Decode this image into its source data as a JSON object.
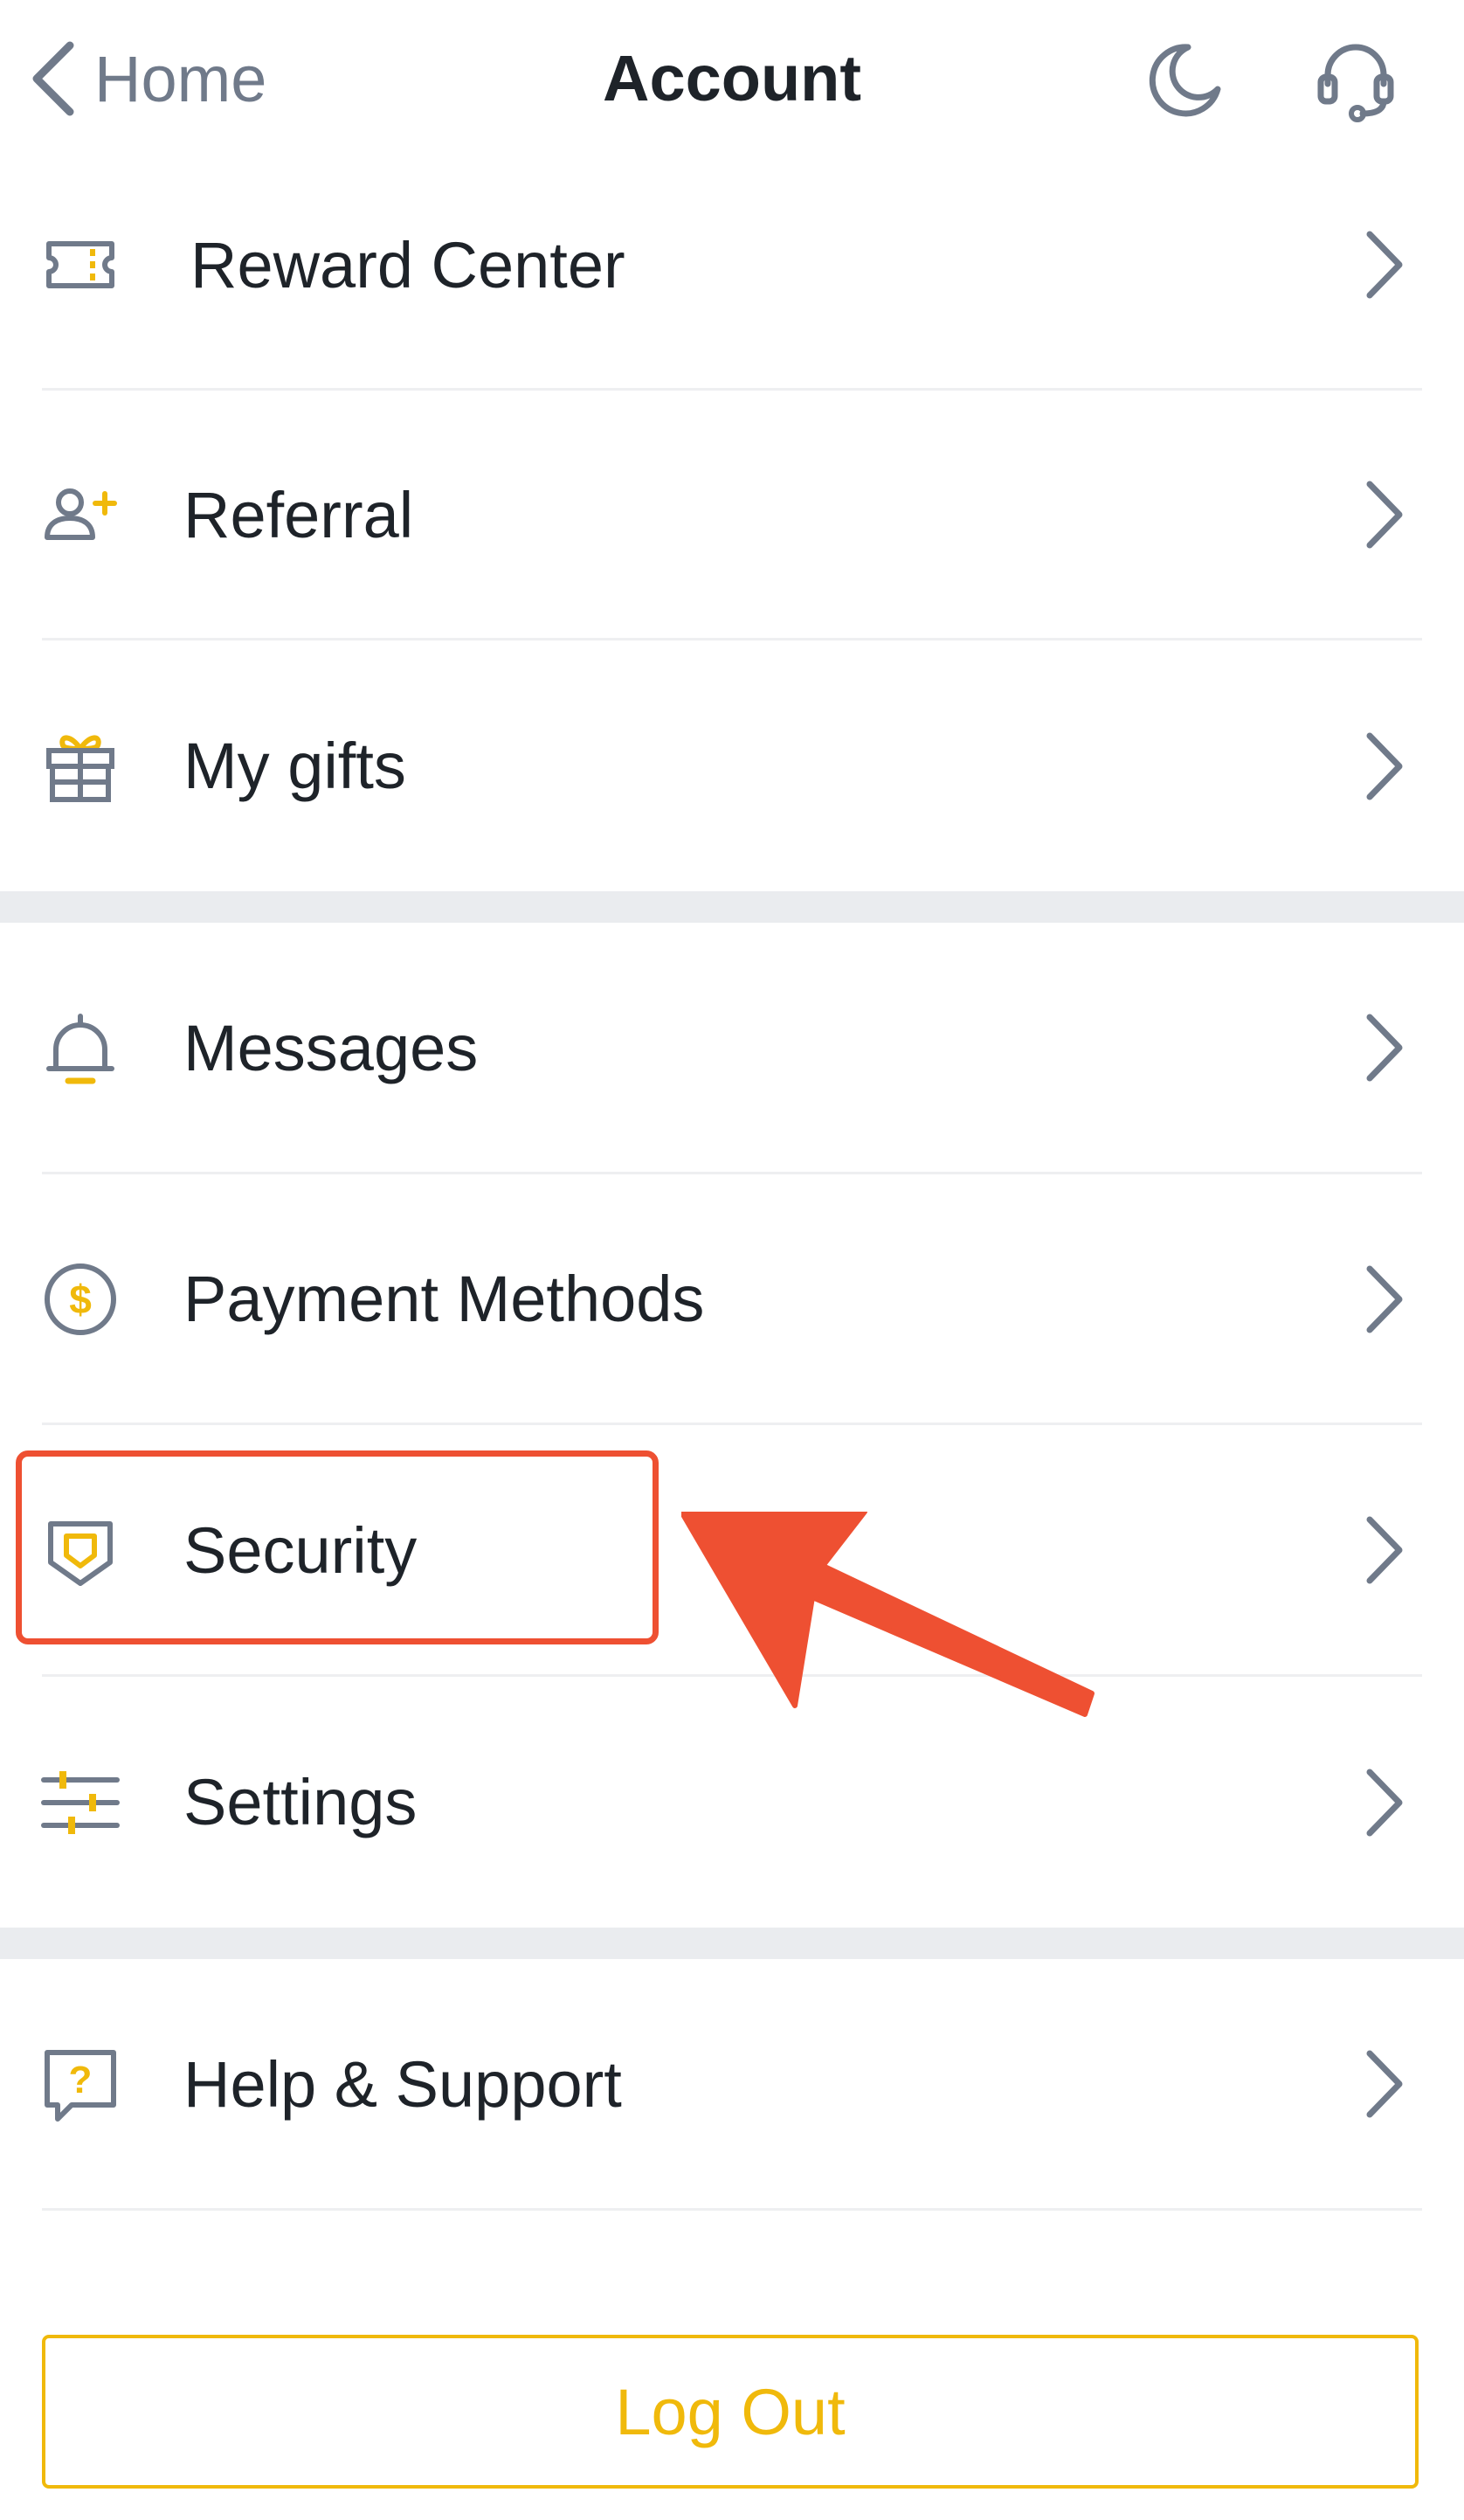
{
  "header": {
    "back_label": "Home",
    "title": "Account",
    "theme_icon": "moon-icon",
    "support_icon": "headset-icon"
  },
  "groups": [
    {
      "items": [
        {
          "label": "Reward Center",
          "icon": "ticket-icon"
        },
        {
          "label": "Referral",
          "icon": "add-user-icon"
        },
        {
          "label": "My gifts",
          "icon": "gift-icon"
        }
      ]
    },
    {
      "items": [
        {
          "label": "Messages",
          "icon": "bell-icon"
        },
        {
          "label": "Payment Methods",
          "icon": "dollar-coin-icon"
        },
        {
          "label": "Security",
          "icon": "shield-icon",
          "highlighted": true
        },
        {
          "label": "Settings",
          "icon": "sliders-icon"
        }
      ]
    },
    {
      "items": [
        {
          "label": "Help & Support",
          "icon": "help-chat-icon"
        }
      ]
    }
  ],
  "logout_label": "Log Out",
  "colors": {
    "accent": "#F0B90B",
    "text": "#1E2329",
    "secondary": "#707A8A",
    "annotation": "#EE5032",
    "section_band": "#EAECEF"
  }
}
